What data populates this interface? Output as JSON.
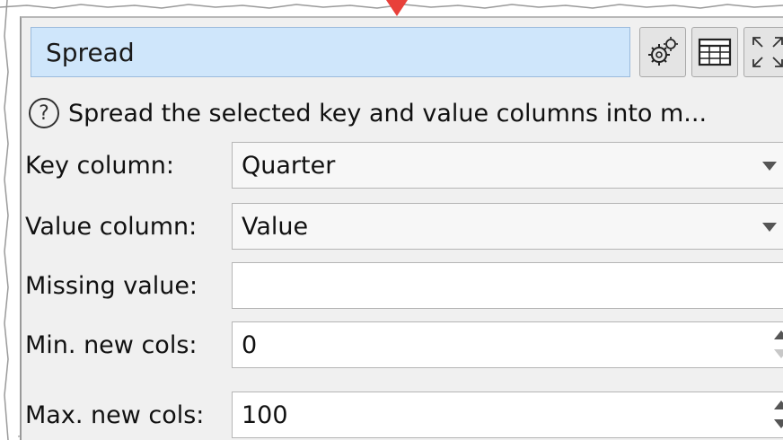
{
  "panel": {
    "title": "Spread",
    "description": "Spread the selected key and value columns into m...",
    "buttons": {
      "settings_icon": "gears-icon",
      "table_icon": "table-icon",
      "expand_icon": "expand-icon"
    }
  },
  "fields": {
    "key_column": {
      "label": "Key column:",
      "value": "Quarter"
    },
    "value_column": {
      "label": "Value column:",
      "value": "Value"
    },
    "missing_value": {
      "label": "Missing value:",
      "value": ""
    },
    "min_new_cols": {
      "label": "Min. new cols:",
      "value": "0"
    },
    "max_new_cols": {
      "label": "Max. new cols:",
      "value": "100"
    }
  },
  "colors": {
    "title_bg": "#cfe6fb",
    "panel_bg": "#f0f0f0",
    "pointer": "#e8403a"
  }
}
